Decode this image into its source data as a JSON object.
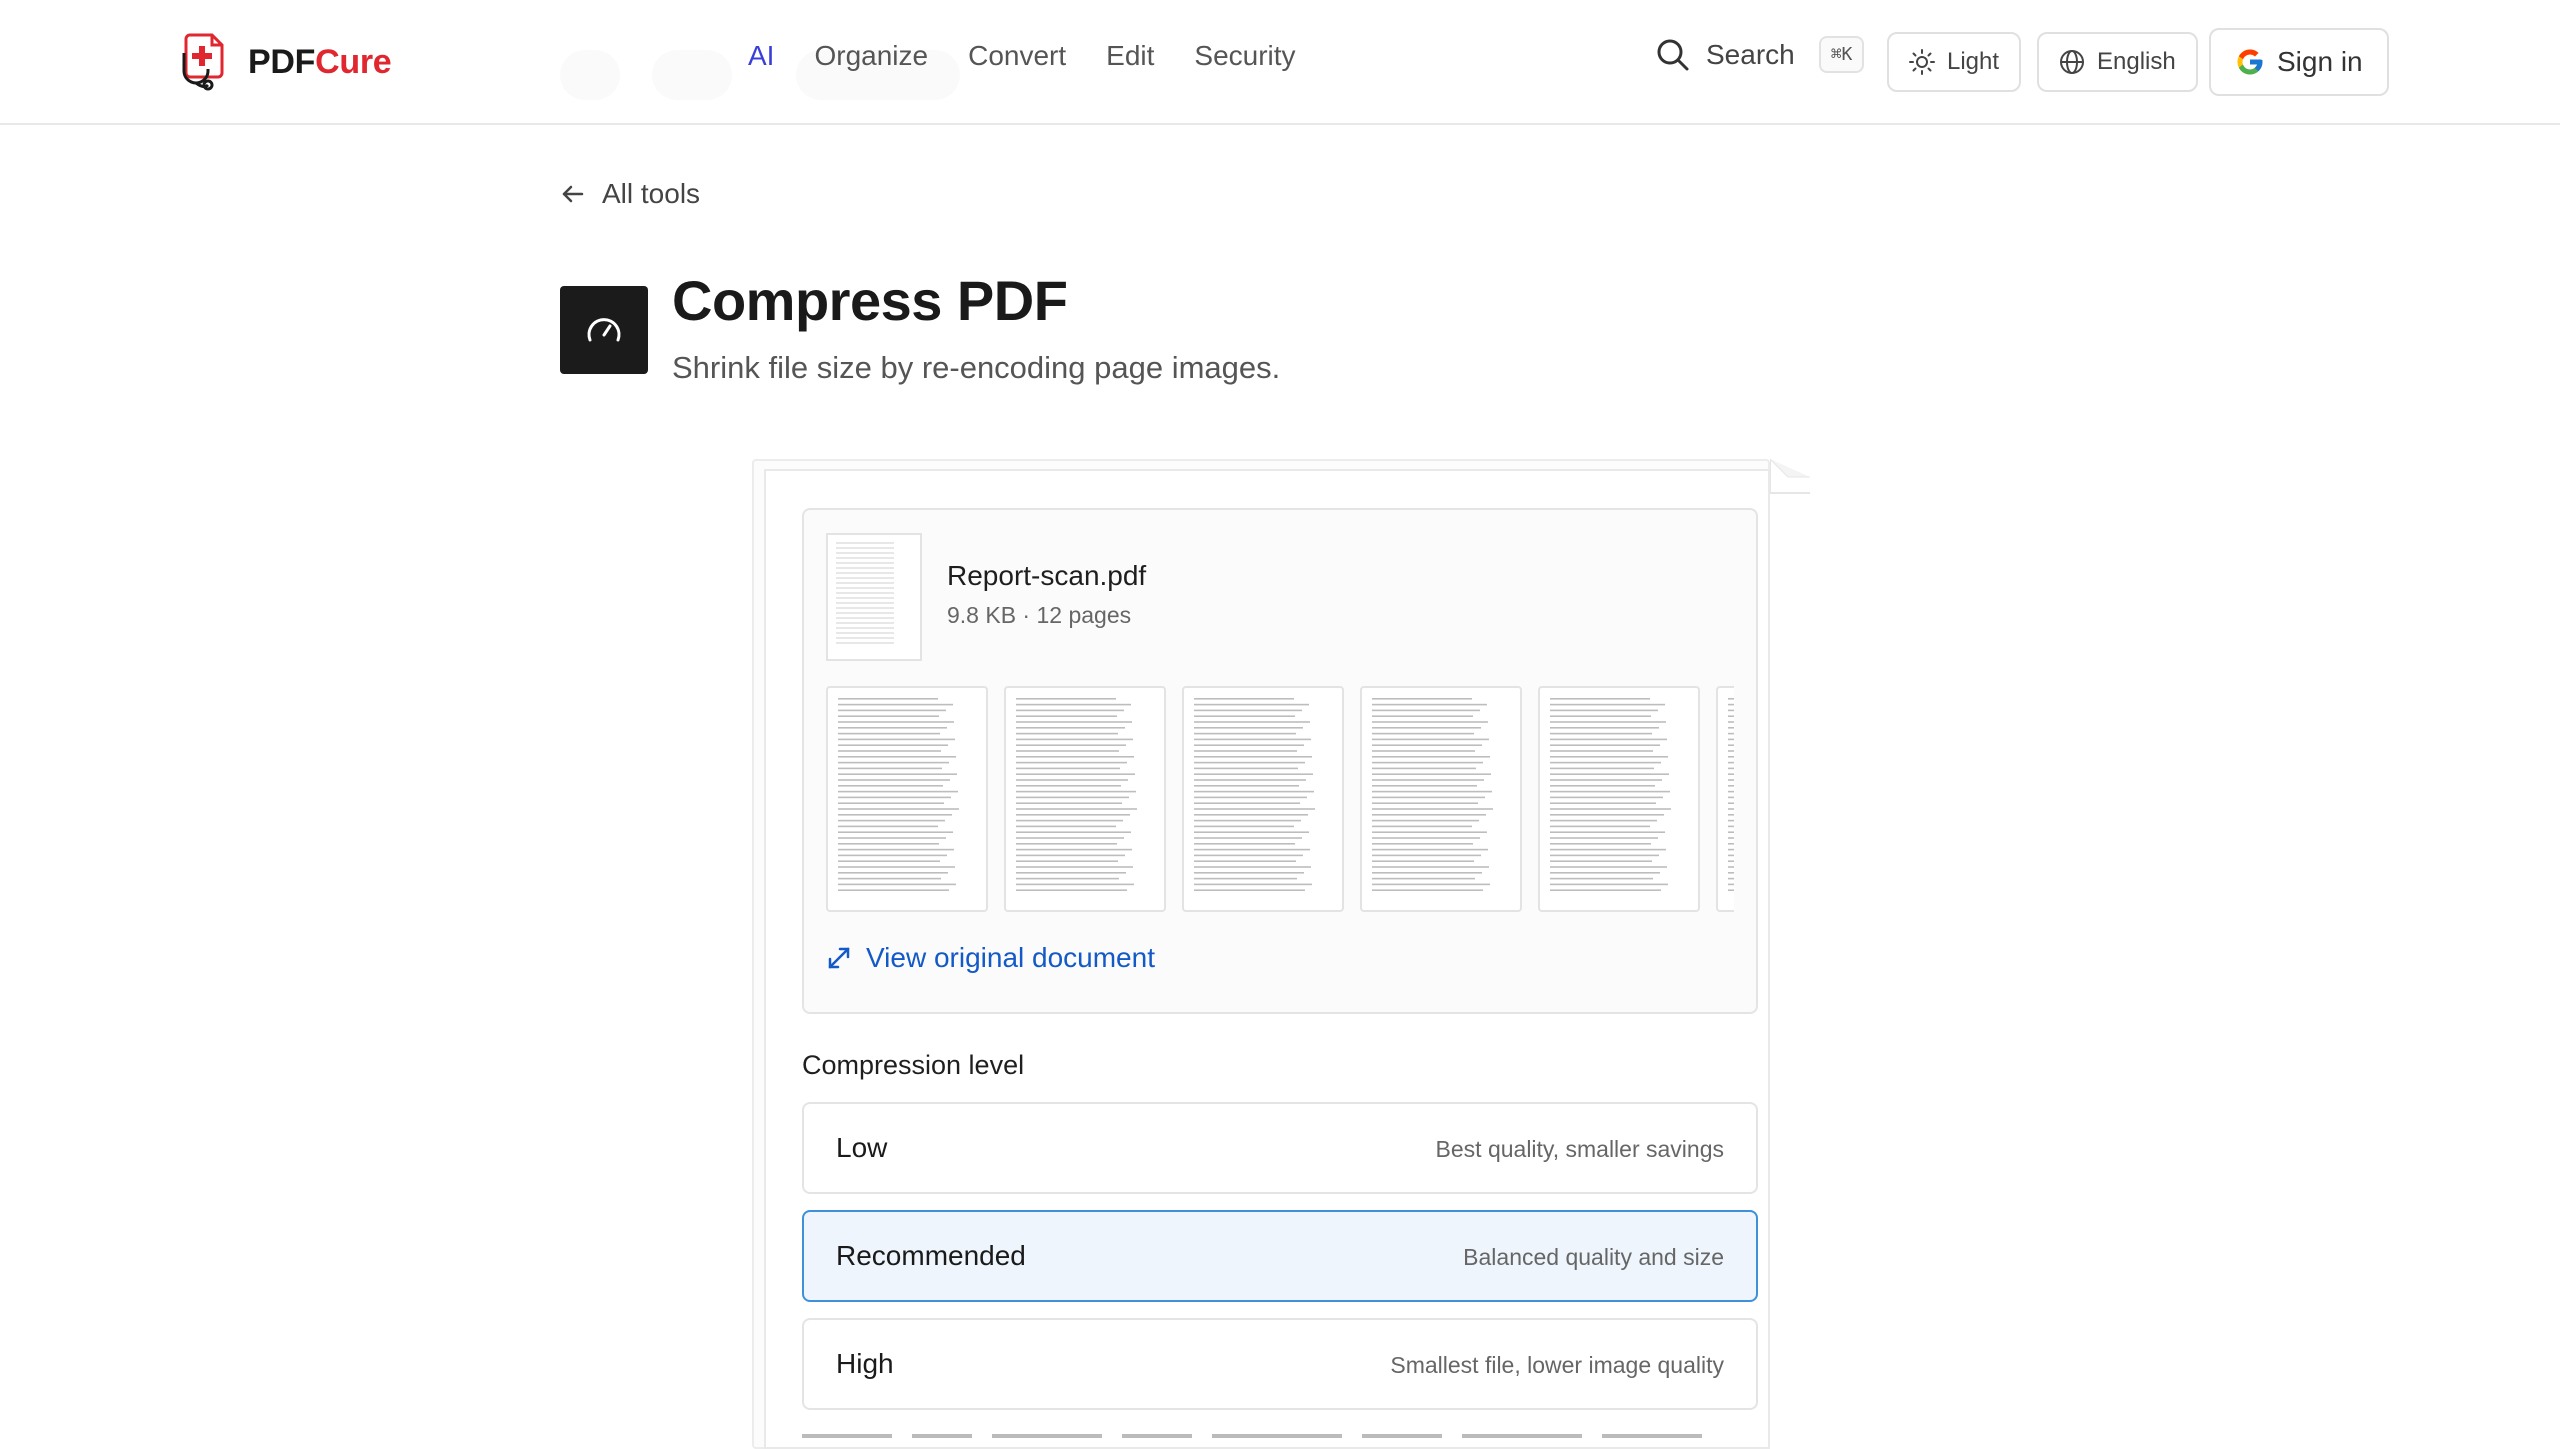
{
  "brand": {
    "part1": "PDF",
    "part2": "Cure",
    "brand_color": "#e0262e"
  },
  "nav": {
    "links": [
      {
        "label": "AI",
        "active": true
      },
      {
        "label": "Organize",
        "active": false
      },
      {
        "label": "Convert",
        "active": false
      },
      {
        "label": "Edit",
        "active": false
      },
      {
        "label": "Security",
        "active": false
      }
    ],
    "search_label": "Search",
    "search_shortcut": "⌘K",
    "theme_label": "Light",
    "language_label": "English",
    "signin_label": "Sign in",
    "accent_color": "#3a3fd9"
  },
  "page": {
    "back_label": "All tools",
    "title": "Compress PDF",
    "subtitle": "Shrink file size by re-encoding page images.",
    "tool_icon": "speedometer-icon"
  },
  "file": {
    "name": "Report-scan.pdf",
    "meta": "9.8 KB · 12 pages",
    "visible_page_thumbs": 5,
    "view_original_label": "View original document",
    "link_color": "#1359c7"
  },
  "compression": {
    "label": "Compression level",
    "options": [
      {
        "title": "Low",
        "description": "Best quality, smaller savings",
        "selected": false
      },
      {
        "title": "Recommended",
        "description": "Balanced quality and size",
        "selected": true
      },
      {
        "title": "High",
        "description": "Smallest file, lower image quality",
        "selected": false
      }
    ],
    "selected_color": "#3f8fd9"
  }
}
